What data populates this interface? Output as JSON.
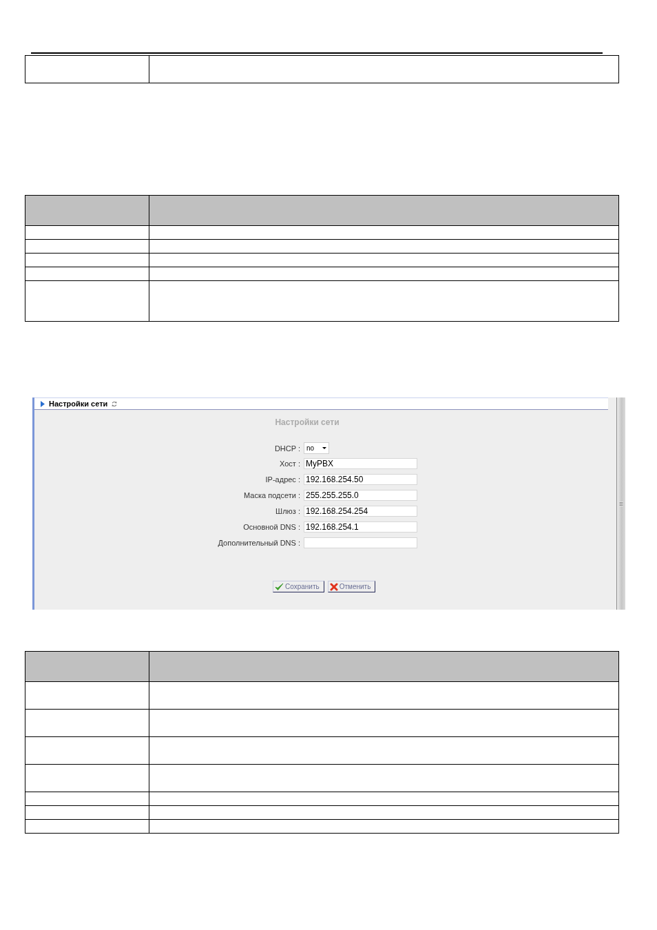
{
  "table_1": {
    "rows": [
      {
        "kind": "double"
      }
    ]
  },
  "table_2": {
    "rows": [
      {
        "kind": "header"
      },
      {
        "kind": "single"
      },
      {
        "kind": "single"
      },
      {
        "kind": "single"
      },
      {
        "kind": "single"
      },
      {
        "kind": "triple"
      }
    ]
  },
  "network_settings_panel": {
    "header_title": "Настройки сети",
    "form_title": "Настройки сети",
    "fields": [
      {
        "label": "DHCP :",
        "kind": "select",
        "value": "no"
      },
      {
        "label": "Хост :",
        "kind": "text",
        "value": "MyPBX"
      },
      {
        "label": "IP-адрес :",
        "kind": "text",
        "value": "192.168.254.50"
      },
      {
        "label": "Маска подсети :",
        "kind": "text",
        "value": "255.255.255.0"
      },
      {
        "label": "Шлюз :",
        "kind": "text",
        "value": "192.168.254.254"
      },
      {
        "label": "Основной DNS :",
        "kind": "text",
        "value": "192.168.254.1"
      },
      {
        "label": "Дополнительный DNS :",
        "kind": "text"
      }
    ],
    "buttons": [
      {
        "label": "Сохранить",
        "kind": "save"
      },
      {
        "label": "Отменить",
        "kind": "cancel"
      }
    ]
  },
  "table_3": {
    "rows": [
      {
        "kind": "header"
      },
      {
        "kind": "double"
      },
      {
        "kind": "double"
      },
      {
        "kind": "double"
      },
      {
        "kind": "double"
      },
      {
        "kind": "single"
      },
      {
        "kind": "single"
      },
      {
        "kind": "single"
      }
    ]
  }
}
